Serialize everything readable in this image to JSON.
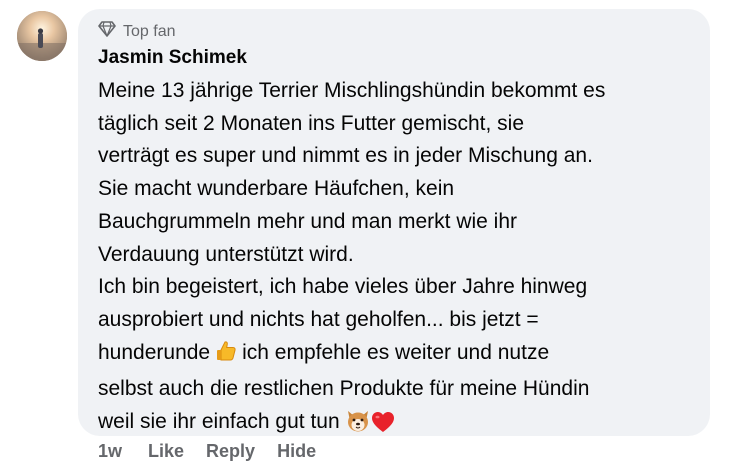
{
  "comment": {
    "badge_label": "Top fan",
    "author": "Jasmin Schimek",
    "text_lines": [
      "Meine 13 jährige Terrier Mischlingshündin bekommt es",
      "täglich seit 2 Monaten ins Futter gemischt, sie",
      "verträgt es super und nimmt es in jeder Mischung an.",
      "Sie macht wunderbare Häufchen, kein",
      "Bauchgrummeln mehr und man merkt wie ihr",
      "Verdauung unterstützt wird.",
      "Ich bin begeistert, ich habe vieles über Jahre hinweg",
      "ausprobiert und nichts hat geholfen... bis jetzt =",
      "hunderunde",
      "ich empfehle es weiter und nutze",
      "selbst auch die restlichen Produkte für meine Hündin",
      "weil sie ihr einfach gut tun"
    ],
    "emojis": [
      "thumbs-up-icon",
      "dog-face-icon",
      "red-heart-icon"
    ]
  },
  "actions": {
    "time": "1w",
    "like": "Like",
    "reply": "Reply",
    "hide": "Hide"
  }
}
